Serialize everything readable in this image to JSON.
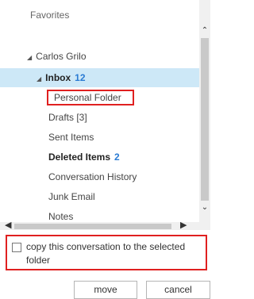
{
  "tree": {
    "favorites_label": "Favorites",
    "account": {
      "expand_glyph": "◢",
      "label": "Carlos Grilo"
    },
    "inbox": {
      "expand_glyph": "◢",
      "label": "Inbox",
      "count": "12"
    },
    "folders": {
      "personal": "Personal Folder",
      "drafts": "Drafts [3]",
      "sent": "Sent Items",
      "deleted": {
        "label": "Deleted Items",
        "count": "2"
      },
      "conversation_history": "Conversation History",
      "junk": "Junk Email",
      "notes": "Notes"
    }
  },
  "scrollbars": {
    "up_glyph": "⌃",
    "down_glyph": "⌄",
    "left_glyph": "◀",
    "right_glyph": "▶"
  },
  "copy_option": {
    "label": "copy this conversation to the selected folder",
    "checked": false
  },
  "buttons": {
    "move_label": "move",
    "cancel_label": "cancel"
  },
  "colors": {
    "selection_bg": "#cde8f7",
    "count_blue": "#2a7bd3",
    "highlight_red": "#e02020"
  }
}
